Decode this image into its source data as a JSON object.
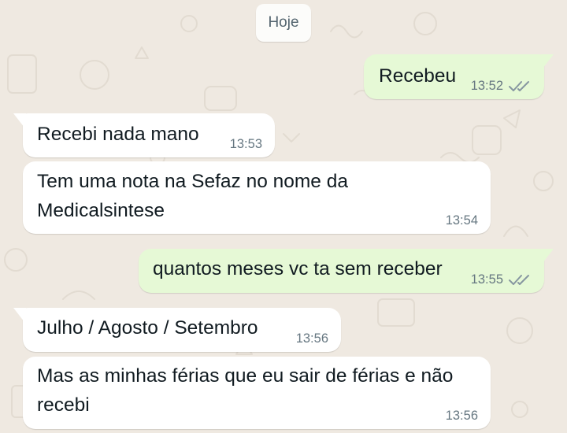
{
  "date_chip": "Hoje",
  "messages": [
    {
      "text": "Recebeu",
      "time": "13:52",
      "dir": "out",
      "ticks": "double-check-icon"
    },
    {
      "text": "Recebi nada mano",
      "time": "13:53",
      "dir": "in"
    },
    {
      "text": "Tem uma nota na Sefaz no nome da\nMedicalsintese",
      "time": "13:54",
      "dir": "in"
    },
    {
      "text": "quantos meses vc ta sem receber",
      "time": "13:55",
      "dir": "out",
      "ticks": "double-check-icon"
    },
    {
      "text": "Julho / Agosto / Setembro",
      "time": "13:56",
      "dir": "in"
    },
    {
      "text": "Mas as minhas férias que eu sair de férias e não\nrecebi",
      "time": "13:56",
      "dir": "in"
    }
  ],
  "colors": {
    "wallpaper": "#efe9e1",
    "incoming_bubble": "#ffffff",
    "outgoing_bubble": "#e6f9d6",
    "timestamp": "#667781",
    "ticks": "#8696a0"
  }
}
